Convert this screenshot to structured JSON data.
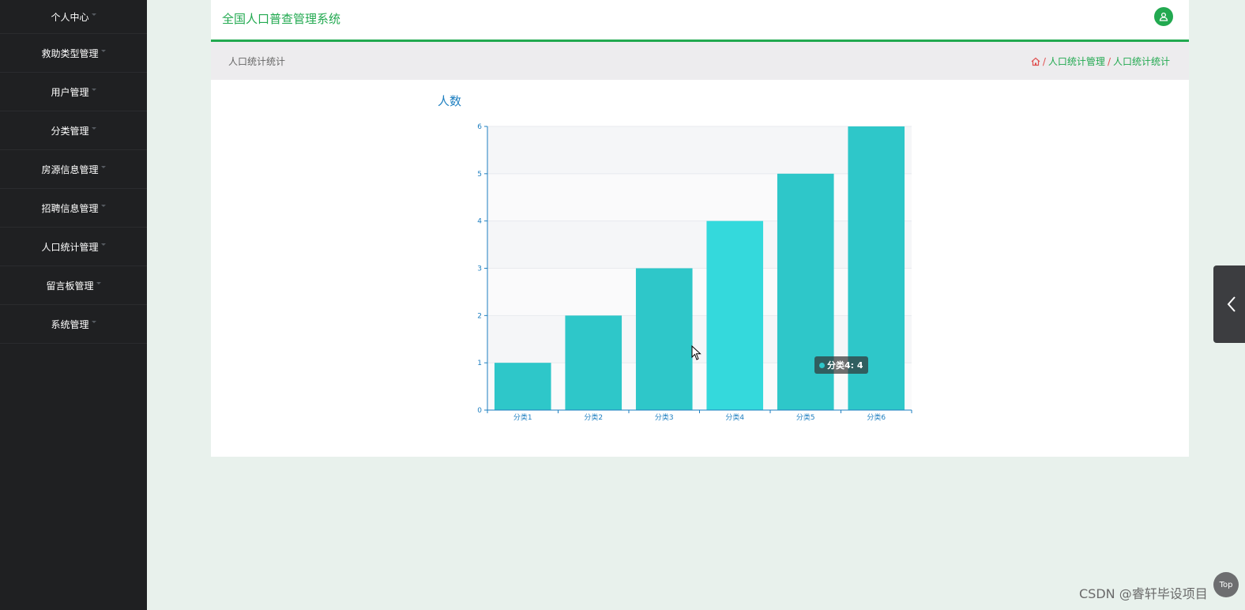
{
  "sidebar": {
    "items": [
      {
        "label": "个人中心"
      },
      {
        "label": "救助类型管理"
      },
      {
        "label": "用户管理"
      },
      {
        "label": "分类管理"
      },
      {
        "label": "房源信息管理"
      },
      {
        "label": "招聘信息管理"
      },
      {
        "label": "人口统计管理"
      },
      {
        "label": "留言板管理"
      },
      {
        "label": "系统管理"
      }
    ]
  },
  "header": {
    "title": "全国人口普查管理系统",
    "avatar_icon": "user-icon"
  },
  "breadcrumb": {
    "page_title": "人口统计统计",
    "home_icon": "home-icon",
    "separator": "/",
    "items": [
      "人口统计管理",
      "人口统计统计"
    ]
  },
  "chart_data": {
    "type": "bar",
    "title": "人数",
    "categories": [
      "分类1",
      "分类2",
      "分类3",
      "分类4",
      "分类5",
      "分类6"
    ],
    "values": [
      1,
      2,
      3,
      4,
      5,
      6
    ],
    "ylim": [
      0,
      6
    ],
    "yticks": [
      0,
      1,
      2,
      3,
      4,
      5,
      6
    ],
    "grid": true,
    "colors": {
      "bar": "#2ec7c9",
      "bar_highlight": "#34d9dc",
      "axis": "#1e7fc0"
    },
    "highlighted_index": 3
  },
  "tooltip": {
    "text": "分类4: 4"
  },
  "controls": {
    "side_handle_icon": "chevron-left-icon",
    "top_label": "Top"
  },
  "watermark": "CSDN @睿轩毕设项目"
}
